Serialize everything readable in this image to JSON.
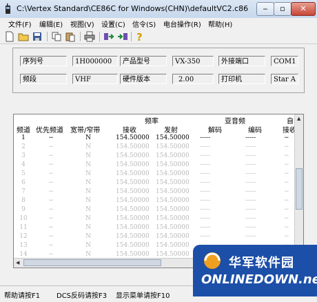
{
  "window": {
    "title": "C:\\Vertex Standard\\CE86C for Windows(CHN)\\defaultVC2.c86 - CE8..."
  },
  "menu": [
    "文件(F)",
    "编辑(E)",
    "视图(V)",
    "设置(C)",
    "信令(S)",
    "电台操作(R)",
    "帮助(H)"
  ],
  "toolbar_icons": [
    "new-file-icon",
    "open-folder-icon",
    "save-icon",
    "copy-icon",
    "paste-icon",
    "print-icon",
    "read-radio-icon",
    "write-radio-icon",
    "help-icon"
  ],
  "info": {
    "row1": {
      "label1": "序列号",
      "val1": "1H000000",
      "label2": "产品型号",
      "val2": "VX-350",
      "label3": "外接端口",
      "val3": "COM1"
    },
    "row2": {
      "label1": "频段",
      "val1": "VHF",
      "label2": "硬件版本",
      "val2": "2.00",
      "label3": "打印机",
      "val3": "Star A"
    }
  },
  "grid": {
    "headers": {
      "channel": "频道",
      "priority": "优先频道",
      "bandwidth": "宽带/窄带",
      "freq_group": "频率",
      "rx": "接收",
      "tx": "发射",
      "subaudio_group": "亚音频",
      "decode": "解码",
      "encode": "编码",
      "last_top": "自电",
      "last_bottom": "接收"
    },
    "rows": [
      {
        "ch": "1",
        "prio": "−",
        "bw": "N",
        "rx": "154.50000",
        "tx": "154.50000",
        "dec": "-----",
        "enc": "-----",
        "last": "−"
      },
      {
        "ch": "2",
        "prio": "−",
        "bw": "N",
        "rx": "154.50000",
        "tx": "154.50000",
        "dec": "-----",
        "enc": "-----",
        "last": "−"
      },
      {
        "ch": "3",
        "prio": "−",
        "bw": "N",
        "rx": "154.50000",
        "tx": "154.50000",
        "dec": "-----",
        "enc": "-----",
        "last": "−"
      },
      {
        "ch": "4",
        "prio": "−",
        "bw": "N",
        "rx": "154.50000",
        "tx": "154.50000",
        "dec": "-----",
        "enc": "-----",
        "last": "−"
      },
      {
        "ch": "5",
        "prio": "−",
        "bw": "N",
        "rx": "154.50000",
        "tx": "154.50000",
        "dec": "-----",
        "enc": "-----",
        "last": "−"
      },
      {
        "ch": "6",
        "prio": "−",
        "bw": "N",
        "rx": "154.50000",
        "tx": "154.50000",
        "dec": "-----",
        "enc": "-----",
        "last": "−"
      },
      {
        "ch": "7",
        "prio": "−",
        "bw": "N",
        "rx": "154.50000",
        "tx": "154.50000",
        "dec": "-----",
        "enc": "-----",
        "last": "−"
      },
      {
        "ch": "8",
        "prio": "−",
        "bw": "N",
        "rx": "154.50000",
        "tx": "154.50000",
        "dec": "-----",
        "enc": "-----",
        "last": "−"
      },
      {
        "ch": "9",
        "prio": "−",
        "bw": "N",
        "rx": "154.50000",
        "tx": "154.50000",
        "dec": "-----",
        "enc": "-----",
        "last": "−"
      },
      {
        "ch": "10",
        "prio": "−",
        "bw": "N",
        "rx": "154.50000",
        "tx": "154.50000",
        "dec": "-----",
        "enc": "-----",
        "last": "−"
      },
      {
        "ch": "11",
        "prio": "−",
        "bw": "N",
        "rx": "154.50000",
        "tx": "154.50000",
        "dec": "-----",
        "enc": "-----",
        "last": "−"
      },
      {
        "ch": "12",
        "prio": "−",
        "bw": "N",
        "rx": "154.50000",
        "tx": "154.50000",
        "dec": "-----",
        "enc": "-----",
        "last": "−"
      },
      {
        "ch": "13",
        "prio": "−",
        "bw": "N",
        "rx": "154.50000",
        "tx": "154.50000",
        "dec": "-----",
        "enc": "-----",
        "last": "−"
      },
      {
        "ch": "14",
        "prio": "−",
        "bw": "N",
        "rx": "154.50000",
        "tx": "154.50000",
        "dec": "-----",
        "enc": "-----",
        "last": "−"
      },
      {
        "ch": "15",
        "prio": "−",
        "bw": "N",
        "rx": "154.50000",
        "tx": "154.50000",
        "dec": "-----",
        "enc": "-----",
        "last": "−"
      }
    ]
  },
  "status": {
    "help": "帮助请按F1",
    "dcs": "DCS反码请按F3",
    "menu": "显示菜单请按F10"
  },
  "watermark": {
    "top": "华军软件园",
    "bottom": "ONLINEDOWN.net"
  }
}
